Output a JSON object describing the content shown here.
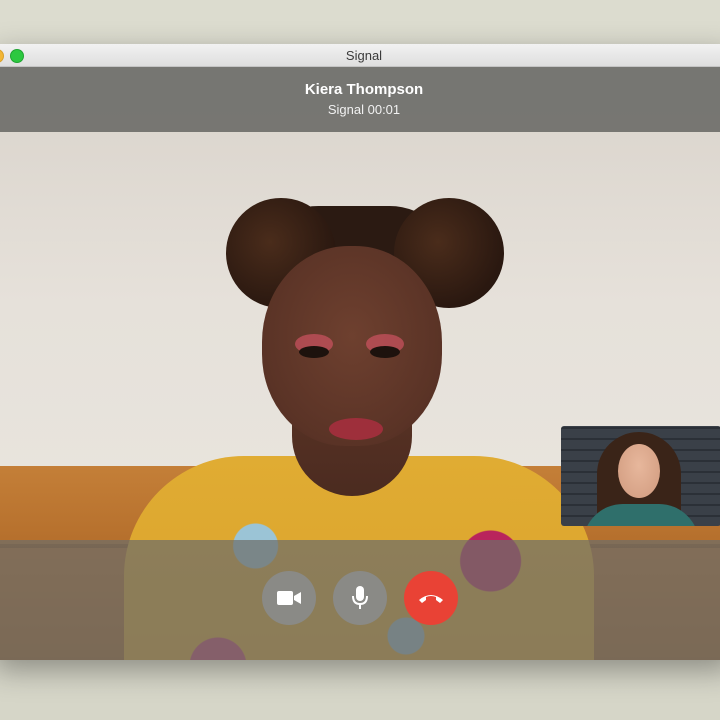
{
  "window": {
    "title": "Signal"
  },
  "call": {
    "caller_name": "Kiera Thompson",
    "status": "Signal 00:01"
  },
  "controls": {
    "video_icon": "video-camera-icon",
    "mic_icon": "microphone-icon",
    "hangup_icon": "phone-hangup-icon"
  },
  "colors": {
    "hangup": "#e94235",
    "control_bg": "#8a8a86",
    "header_bg": "#6e6e6a"
  }
}
